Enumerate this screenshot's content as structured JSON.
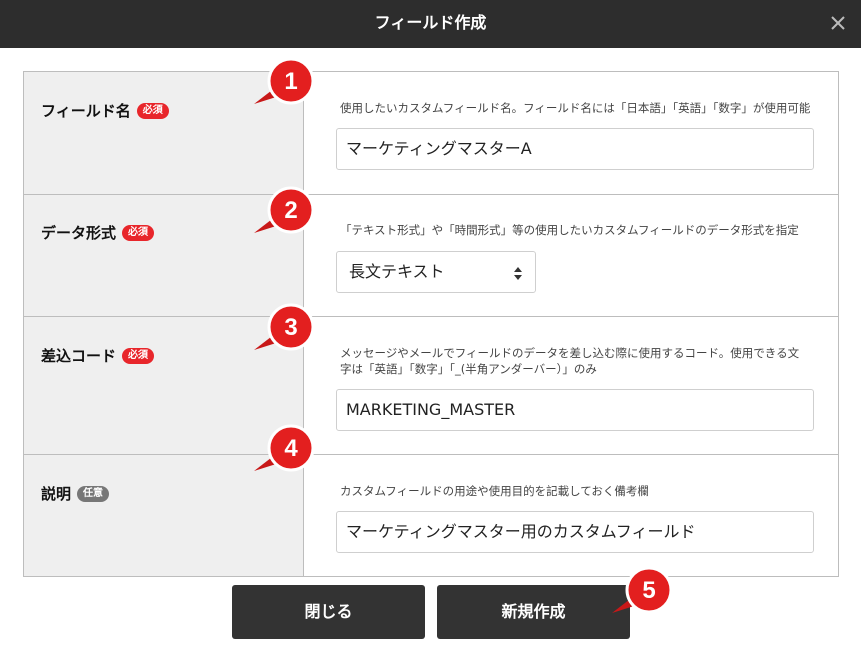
{
  "dialog": {
    "title": "フィールド作成"
  },
  "rows": [
    {
      "label": "フィールド名",
      "badge": "必須",
      "description": "使用したいカスタムフィールド名。フィールド名には「日本語」「英語」「数字」が使用可能",
      "value": "マーケティングマスターA"
    },
    {
      "label": "データ形式",
      "badge": "必須",
      "description": "「テキスト形式」や「時間形式」等の使用したいカスタムフィールドのデータ形式を指定",
      "selected": "長文テキスト"
    },
    {
      "label": "差込コード",
      "badge": "必須",
      "description_line1": "メッセージやメールでフィールドのデータを差し込む際に使用するコード。使用できる文",
      "description_line2": "字は「英語」「数字」「_(半角アンダーバー）」のみ",
      "value": "MARKETING_MASTER"
    },
    {
      "label": "説明",
      "badge": "任意",
      "description": "カスタムフィールドの用途や使用目的を記載しておく備考欄",
      "value": "マーケティングマスター用のカスタムフィールド"
    }
  ],
  "markers": [
    "1",
    "2",
    "3",
    "4",
    "5"
  ],
  "buttons": {
    "close": "閉じる",
    "create": "新規作成"
  },
  "colors": {
    "titlebar": "#2d2d2d",
    "required_badge": "#e8262b",
    "optional_badge": "#777777",
    "marker": "#e31f1f",
    "button": "#333333"
  },
  "icons": {
    "close": "close-icon",
    "select_arrows": "select-arrows-icon"
  }
}
